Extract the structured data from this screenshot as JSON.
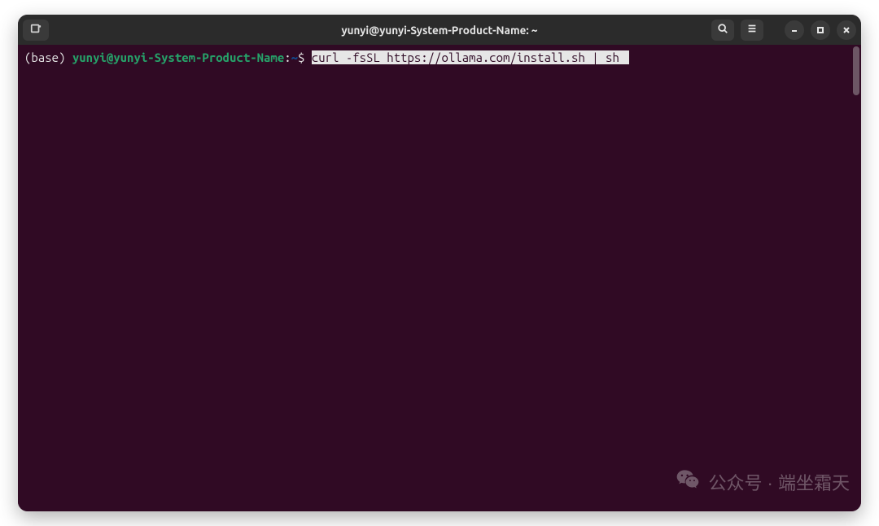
{
  "titlebar": {
    "title": "yunyi@yunyi-System-Product-Name: ~"
  },
  "prompt": {
    "env": "(base) ",
    "user_host": "yunyi@yunyi-System-Product-Name",
    "colon": ":",
    "cwd": "~",
    "dollar": "$ ",
    "command": "curl -fsSL https://ollama.com/install.sh | sh "
  },
  "watermark": {
    "text": "公众号 · 端坐霜天"
  }
}
